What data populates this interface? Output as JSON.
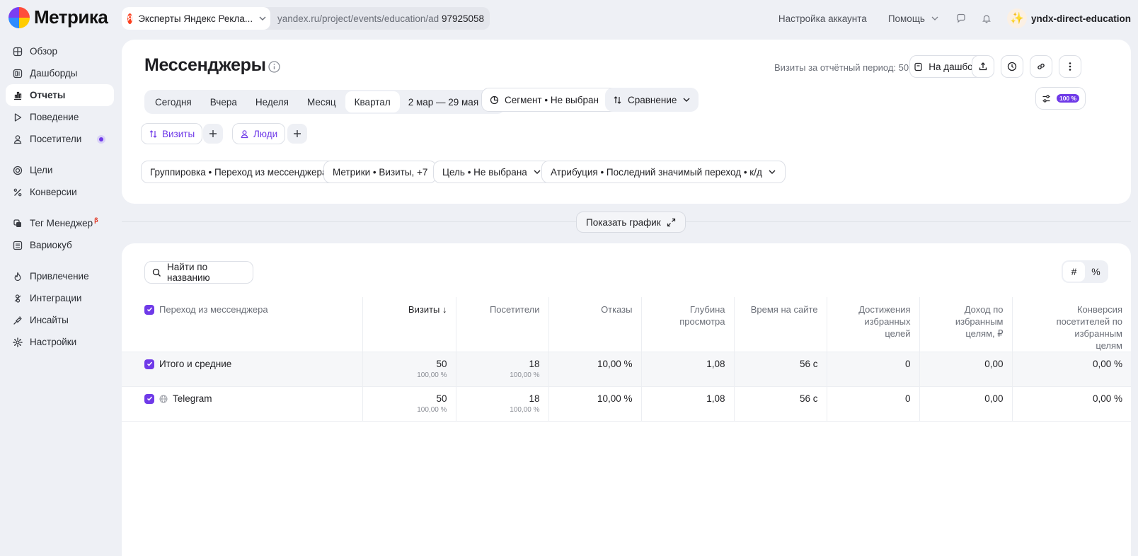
{
  "app": {
    "name": "Метрика"
  },
  "counter": {
    "name": "Эксперты Яндекс Рекла...",
    "url": "yandex.ru/project/events/education/ad...",
    "id": "97925058"
  },
  "header": {
    "account_settings": "Настройка аккаунта",
    "help": "Помощь",
    "user": "yndx-direct-education"
  },
  "sidebar": {
    "items": [
      {
        "label": "Обзор",
        "icon": "grid-icon"
      },
      {
        "label": "Дашборды",
        "icon": "dashboard-icon"
      },
      {
        "label": "Отчеты",
        "icon": "bar-chart-icon",
        "active": true
      },
      {
        "label": "Поведение",
        "icon": "play-icon"
      },
      {
        "label": "Посетители",
        "icon": "person-icon"
      },
      {
        "label": "Цели",
        "icon": "target-icon"
      },
      {
        "label": "Конверсии",
        "icon": "percent-icon"
      },
      {
        "label": "Тег Менеджер",
        "icon": "tag-manager-icon",
        "badge": "β"
      },
      {
        "label": "Вариокуб",
        "icon": "variocube-icon"
      },
      {
        "label": "Привлечение",
        "icon": "flame-icon"
      },
      {
        "label": "Интеграции",
        "icon": "integrations-icon"
      },
      {
        "label": "Инсайты",
        "icon": "insights-icon"
      },
      {
        "label": "Настройки",
        "icon": "gear-icon"
      }
    ]
  },
  "report": {
    "title": "Мессенджеры",
    "visits_total": "Визиты за отчётный период: 50",
    "to_dashboard": "На дашборд",
    "periods": [
      "Сегодня",
      "Вчера",
      "Неделя",
      "Месяц",
      "Квартал"
    ],
    "active_period": "Квартал",
    "date_range": "2 мар — 29 мая",
    "segment": "Сегмент • Не выбран",
    "compare": "Сравнение",
    "sampling": "100 %",
    "chips": {
      "visits": "Визиты",
      "people": "Люди"
    },
    "filters": {
      "grouping": "Группировка • Переход из мессенджера",
      "metrics": "Метрики • Визиты, +7",
      "goal": "Цель • Не выбрана",
      "attribution": "Атрибуция • Последний значимый переход • к/д"
    },
    "show_graph": "Показать график"
  },
  "table": {
    "search_placeholder": "Найти по названию",
    "mode": [
      "#",
      "%"
    ],
    "headers": {
      "dimension": "Переход из мессенджера",
      "visits": "Визиты",
      "visitors": "Посетители",
      "bounces": "Отказы",
      "depth": "Глубина просмотра",
      "time": "Время на сайте",
      "goals": "Достижения избранных целей",
      "revenue": "Доход по избранным целям, ₽",
      "conversion": "Конверсия посетителей по избранным целям"
    },
    "rows": [
      {
        "name": "Итого и средние",
        "visits": "50",
        "visits_pct": "100,00 %",
        "visitors": "18",
        "visitors_pct": "100,00 %",
        "bounces": "10,00 %",
        "depth": "1,08",
        "time": "56 с",
        "goals": "0",
        "revenue": "0,00",
        "conversion": "0,00 %"
      },
      {
        "name": "Telegram",
        "visits": "50",
        "visits_pct": "100,00 %",
        "visitors": "18",
        "visitors_pct": "100,00 %",
        "bounces": "10,00 %",
        "depth": "1,08",
        "time": "56 с",
        "goals": "0",
        "revenue": "0,00",
        "conversion": "0,00 %"
      }
    ]
  }
}
